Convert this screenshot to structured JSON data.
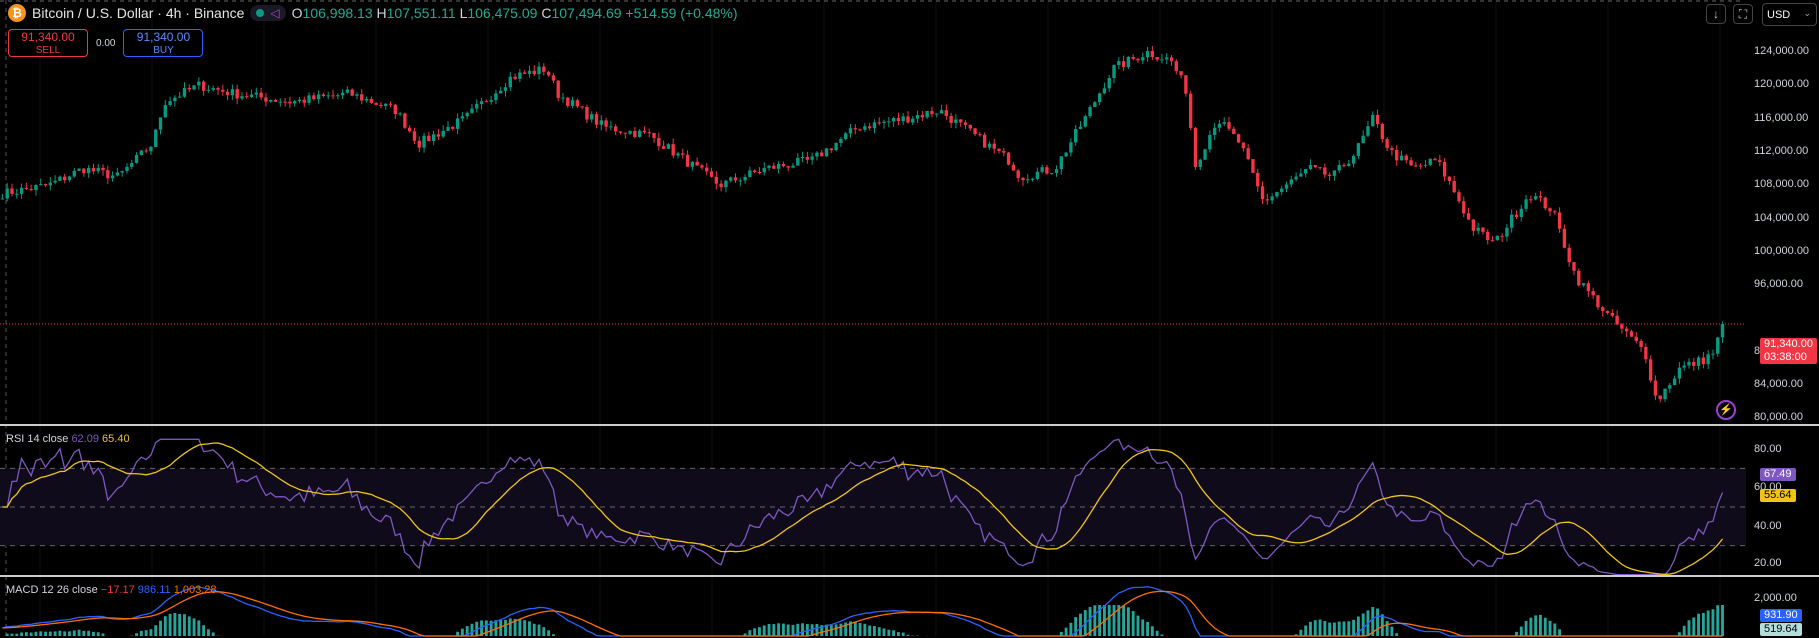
{
  "header": {
    "title": "Bitcoin / U.S. Dollar · 4h · Binance",
    "coin_icon": "bitcoin-icon",
    "ohlc": {
      "o_label": "O",
      "o": "106,998.13",
      "h_label": "H",
      "h": "107,551.11",
      "l_label": "L",
      "l": "106,475.09",
      "c_label": "C",
      "c": "107,494.69",
      "change": "+514.59 (+0.48%)"
    }
  },
  "trade": {
    "sell_price": "91,340.00",
    "sell_label": "SELL",
    "spread": "0.00",
    "buy_price": "91,340.00",
    "buy_label": "BUY"
  },
  "toolbar": {
    "currency": "USD"
  },
  "price_axis": {
    "labels": [
      "124,000.00",
      "120,000.00",
      "116,000.00",
      "112,000.00",
      "108,000.00",
      "104,000.00",
      "100,000.00",
      "96,000.00",
      "88,000.00",
      "84,000.00",
      "80,000.00"
    ],
    "last_price": "91,340.00",
    "countdown": "03:38:00"
  },
  "rsi": {
    "label": "RSI 14 close",
    "value": "62.09",
    "ma": "65.40",
    "axis": [
      "80.00",
      "60.00",
      "40.00",
      "20.00"
    ],
    "tag_rsi": "67.49",
    "tag_ma": "55.64"
  },
  "macd": {
    "label": "MACD 12 26 close",
    "hist": "−17.17",
    "macd": "986.11",
    "signal": "1,003.28",
    "axis": [
      "2,000.00"
    ],
    "tag_macd": "931.90",
    "tag_signal": "519.64"
  },
  "colors": {
    "up": "#089981",
    "down": "#f23645",
    "rsi": "#7e57c2",
    "rsi_ma": "#f0c419",
    "macd": "#2962ff",
    "signal": "#ff6d00"
  },
  "chart_data": {
    "type": "candlestick",
    "ylim": [
      78000,
      126000
    ],
    "close_path": [
      [
        0,
        107000
      ],
      [
        40,
        108000
      ],
      [
        70,
        110000
      ],
      [
        100,
        109000
      ],
      [
        130,
        113000
      ],
      [
        140,
        118000
      ],
      [
        170,
        120000
      ],
      [
        200,
        119000
      ],
      [
        250,
        118000
      ],
      [
        300,
        119000
      ],
      [
        340,
        117000
      ],
      [
        360,
        113000
      ],
      [
        400,
        116000
      ],
      [
        440,
        121000
      ],
      [
        470,
        122000
      ],
      [
        480,
        119000
      ],
      [
        520,
        115000
      ],
      [
        560,
        114000
      ],
      [
        600,
        110000
      ],
      [
        620,
        108000
      ],
      [
        660,
        110000
      ],
      [
        700,
        111000
      ],
      [
        740,
        115000
      ],
      [
        780,
        116000
      ],
      [
        810,
        117000
      ],
      [
        840,
        114000
      ],
      [
        870,
        111000
      ],
      [
        880,
        109000
      ],
      [
        910,
        110000
      ],
      [
        940,
        117000
      ],
      [
        960,
        122000
      ],
      [
        990,
        124000
      ],
      [
        1010,
        123000
      ],
      [
        1025,
        119000
      ],
      [
        1030,
        110000
      ],
      [
        1050,
        116000
      ],
      [
        1070,
        113000
      ],
      [
        1090,
        106000
      ],
      [
        1110,
        108000
      ],
      [
        1130,
        110000
      ],
      [
        1150,
        109000
      ],
      [
        1170,
        112000
      ],
      [
        1185,
        116000
      ],
      [
        1200,
        112000
      ],
      [
        1220,
        110000
      ],
      [
        1240,
        111000
      ],
      [
        1260,
        106000
      ],
      [
        1270,
        103000
      ],
      [
        1290,
        101000
      ],
      [
        1300,
        103000
      ],
      [
        1320,
        107000
      ],
      [
        1340,
        105000
      ],
      [
        1360,
        97000
      ],
      [
        1390,
        92000
      ],
      [
        1420,
        88000
      ],
      [
        1430,
        82000
      ],
      [
        1450,
        86000
      ],
      [
        1470,
        87000
      ],
      [
        1480,
        88000
      ],
      [
        1487,
        91340
      ]
    ]
  }
}
